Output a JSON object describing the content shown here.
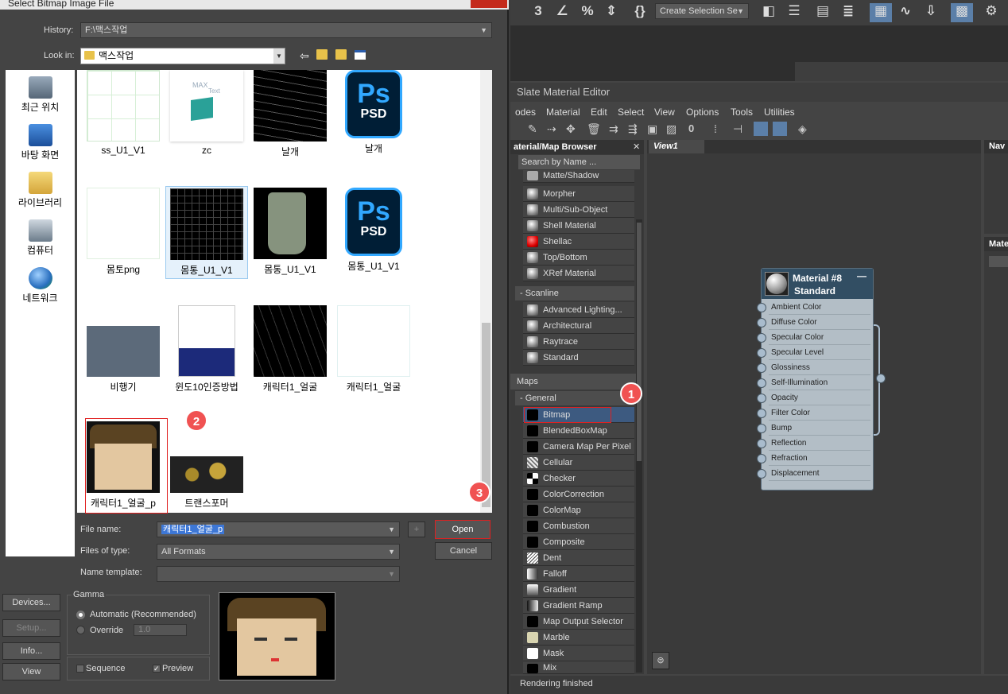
{
  "dialog": {
    "title": "Select Bitmap Image File",
    "history_label": "History:",
    "history_value": "F:\\맥스작업",
    "lookin_label": "Look in:",
    "lookin_value": "맥스작업",
    "places": [
      "최근 위치",
      "바탕 화면",
      "라이브러리",
      "컴퓨터",
      "네트워크"
    ],
    "files": [
      "ss_U1_V1",
      "zc",
      "날개",
      "날개",
      "몸토png",
      "몸통_U1_V1",
      "몸통_U1_V1",
      "몸통_U1_V1",
      "비행기",
      "윈도10인증방법",
      "캐릭터1_얼굴",
      "캐릭터1_얼굴",
      "캐릭터1_얼굴_p",
      "트랜스포머"
    ],
    "zc_thumb": {
      "max": "MAX",
      "text": "Text"
    },
    "ps": "Ps",
    "psd": "PSD",
    "filename_label": "File name:",
    "filename_value": "캐릭터1_얼굴_p",
    "filetype_label": "Files of type:",
    "filetype_value": "All Formats",
    "nametemplate_label": "Name template:",
    "plus": "+",
    "open": "Open",
    "cancel": "Cancel",
    "devices": "Devices...",
    "setup": "Setup...",
    "info": "Info...",
    "view": "View",
    "gamma": "Gamma",
    "automatic": "Automatic (Recommended)",
    "override": "Override",
    "override_value": "1.0",
    "sequence": "Sequence",
    "preview": "Preview"
  },
  "badges": [
    "1",
    "2",
    "3"
  ],
  "toolbar": {
    "create_selection": "Create Selection Se"
  },
  "sme": {
    "title": "Slate Material Editor",
    "menu": [
      "odes",
      "Material",
      "Edit",
      "Select",
      "View",
      "Options",
      "Tools",
      "Utilities"
    ],
    "browser_title": "aterial/Map Browser",
    "search": "Search by Name ...",
    "materials": [
      "Matte/Shadow",
      "Morpher",
      "Multi/Sub-Object",
      "Shell Material",
      "Shellac",
      "Top/Bottom",
      "XRef Material"
    ],
    "scanline": "- Scanline",
    "scanline_items": [
      "Advanced Lighting...",
      "Architectural",
      "Raytrace",
      "Standard"
    ],
    "maps": "Maps",
    "general": "- General",
    "map_items": [
      "Bitmap",
      "BlendedBoxMap",
      "Camera Map Per Pixel",
      "Cellular",
      "Checker",
      "ColorCorrection",
      "ColorMap",
      "Combustion",
      "Composite",
      "Dent",
      "Falloff",
      "Gradient",
      "Gradient Ramp",
      "Map Output Selector",
      "Marble",
      "Mask",
      "Mix"
    ],
    "view_tab": "View1",
    "nav": "Nav",
    "mate": "Mate",
    "node_title": "Material #8",
    "node_sub": "Standard",
    "node_minus": "—",
    "slots": [
      "Ambient Color",
      "Diffuse Color",
      "Specular Color",
      "Specular Level",
      "Glossiness",
      "Self-Illumination",
      "Opacity",
      "Filter Color",
      "Bump",
      "Reflection",
      "Refraction",
      "Displacement"
    ],
    "status": "Rendering finished"
  },
  "colors": {
    "accent": "#324e63",
    "badge": "#f05252",
    "selection": "#3d5a80"
  }
}
